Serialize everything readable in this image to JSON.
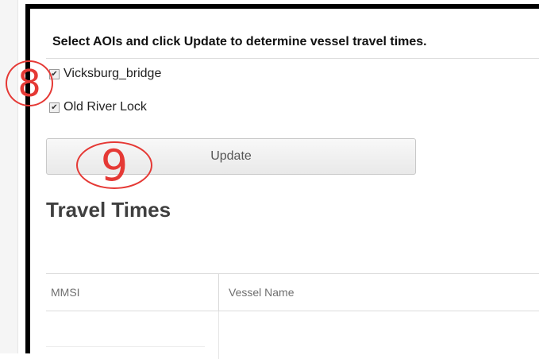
{
  "instruction": "Select AOIs and click Update to determine vessel travel times.",
  "aois": [
    {
      "label": "Vicksburg_bridge",
      "checked": true
    },
    {
      "label": "Old River Lock",
      "checked": true
    }
  ],
  "update_label": "Update",
  "heading": "Travel Times",
  "table": {
    "columns": [
      "MMSI",
      "Vessel Name"
    ]
  },
  "annotations": [
    "8",
    "9"
  ],
  "colors": {
    "annotation": "#e53935",
    "frame": "#000000"
  }
}
